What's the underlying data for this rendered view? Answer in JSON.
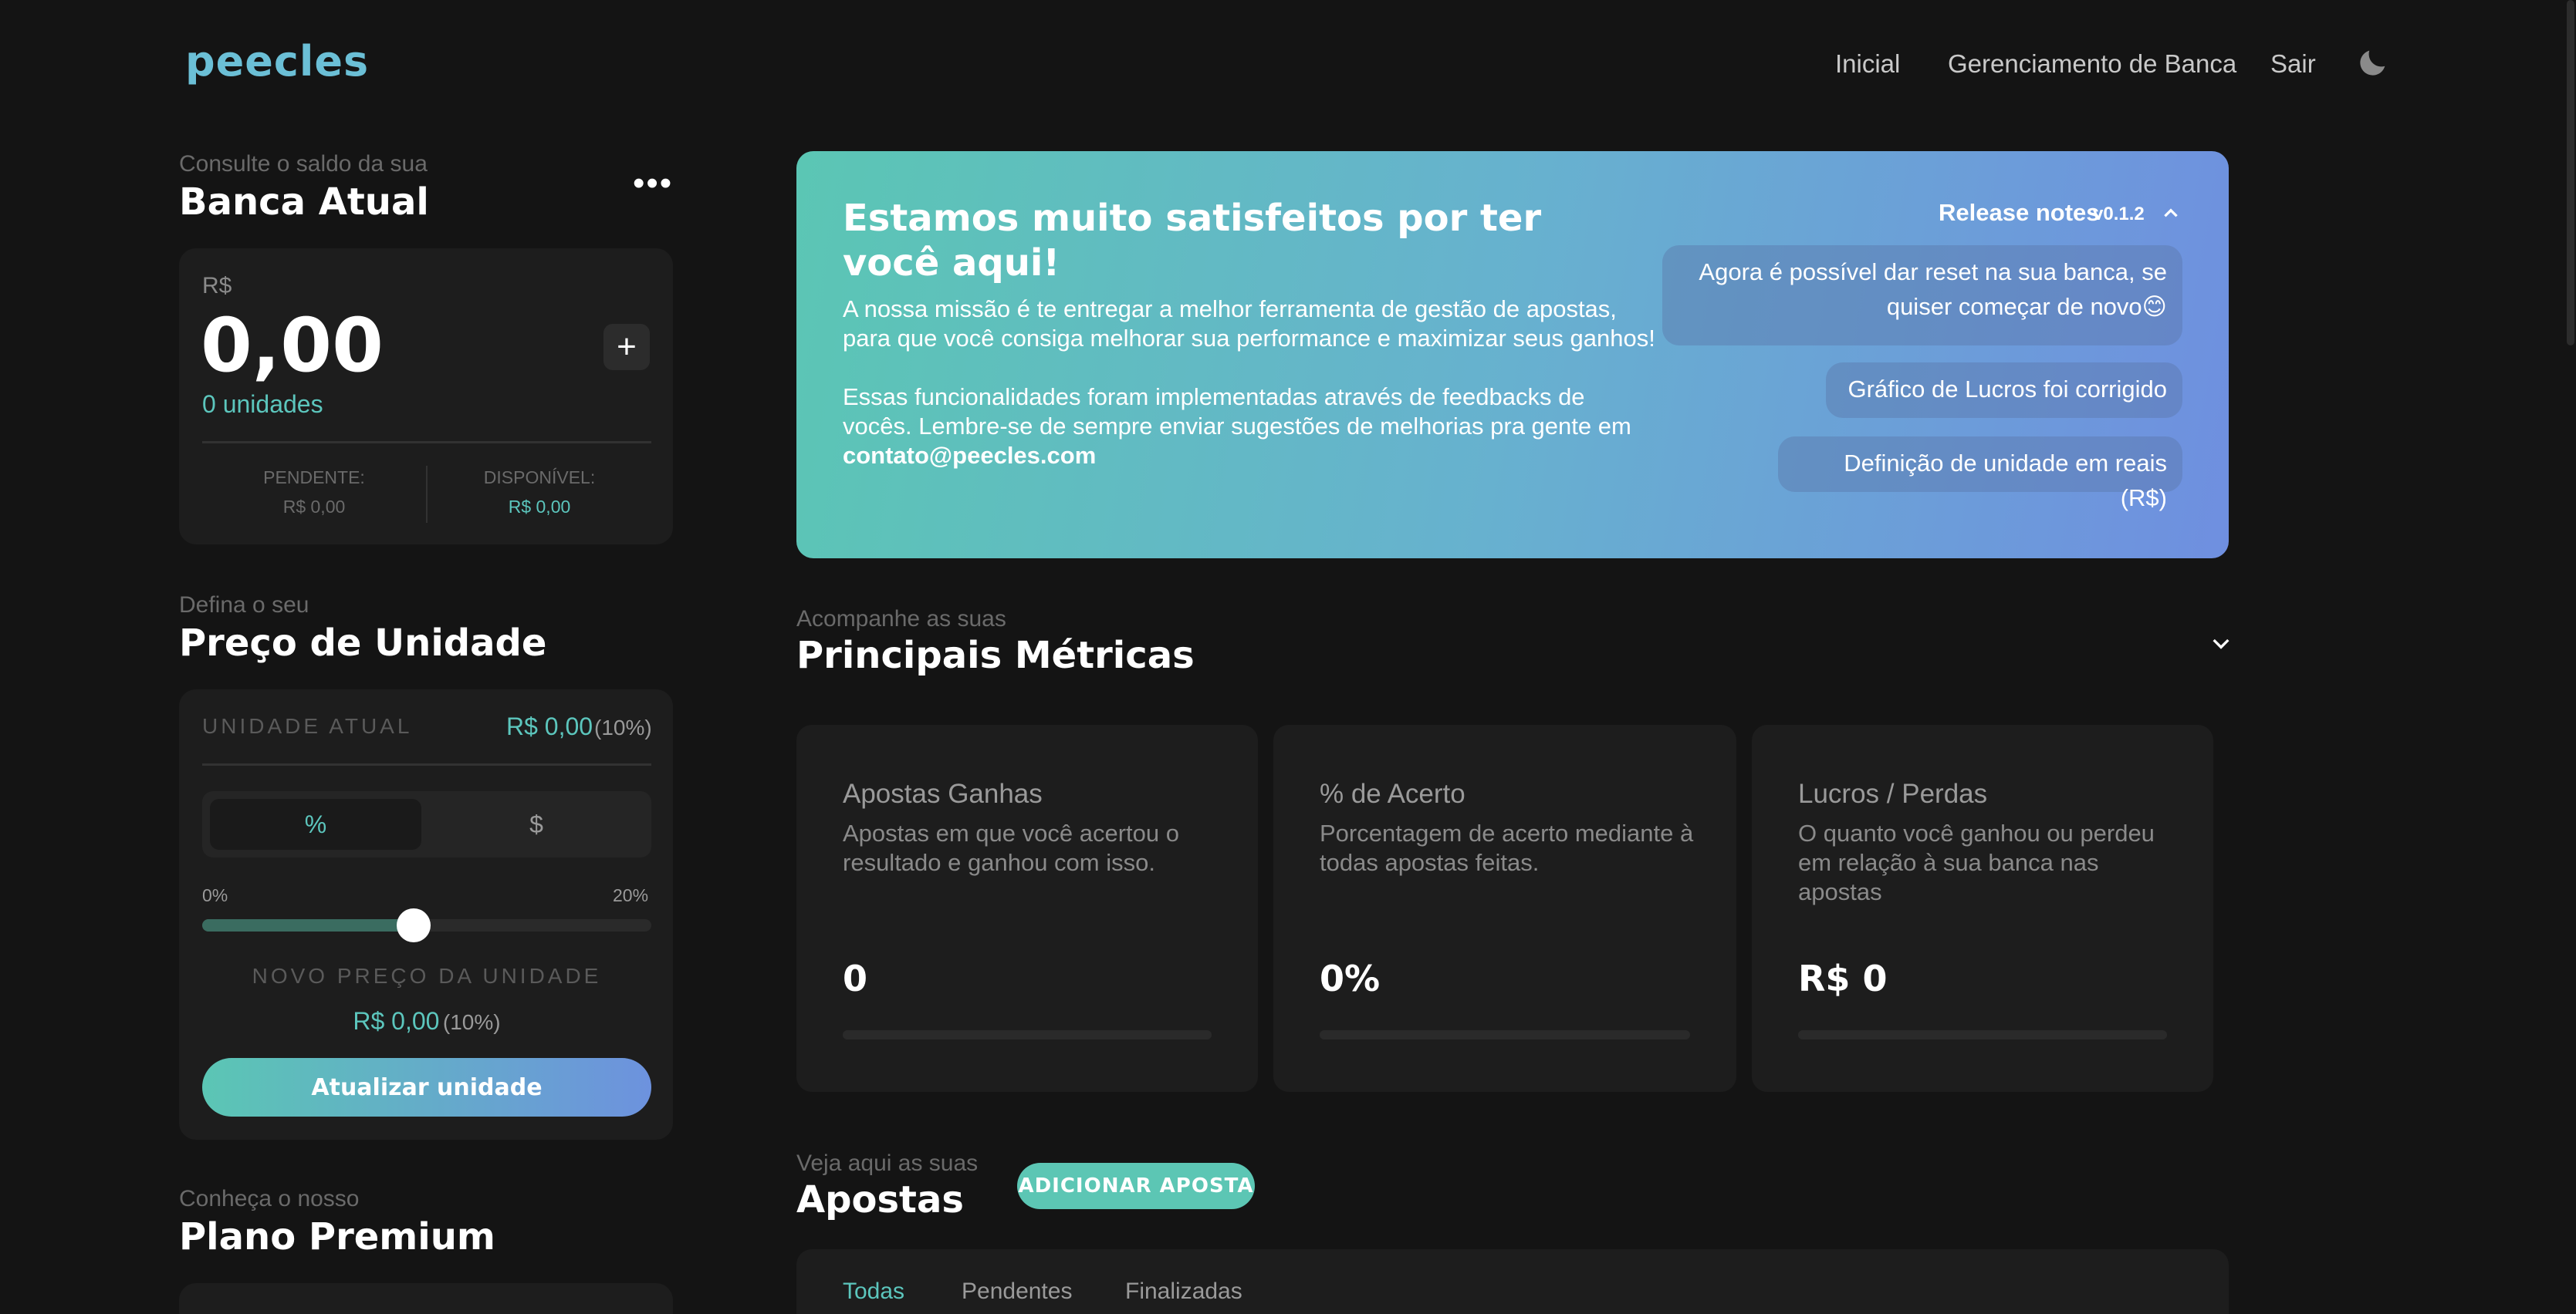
{
  "header": {
    "logo": "peecles",
    "nav": [
      "Inicial",
      "Gerenciamento de Banca",
      "Sair"
    ],
    "theme_icon": "moon-icon"
  },
  "bank": {
    "eyebrow": "Consulte o saldo da sua",
    "title": "Banca Atual",
    "menu": "•••",
    "currency": "R$",
    "amount": "0,00",
    "units": "0 unidades",
    "add": "+",
    "pending_label": "PENDENTE:",
    "pending_value": "R$ 0,00",
    "available_label": "DISPONÍVEL:",
    "available_value": "R$ 0,00"
  },
  "unit": {
    "eyebrow": "Defina o seu",
    "title": "Preço de Unidade",
    "current_label": "UNIDADE ATUAL",
    "current_value": "R$ 0,00",
    "current_pct": "(10%)",
    "mode_percent": "%",
    "mode_currency": "$",
    "slider_min": "0%",
    "slider_max": "20%",
    "slider_value": 0.47,
    "new_label": "NOVO PREÇO DA UNIDADE",
    "new_value": "R$ 0,00",
    "new_pct": "(10%)",
    "update_button": "Atualizar unidade"
  },
  "premium": {
    "eyebrow": "Conheça o nosso",
    "title": "Plano Premium"
  },
  "hero": {
    "title": "Estamos muito satisfeitos por ter você aqui!",
    "text1": "A nossa missão é te entregar a melhor ferramenta de gestão de apostas, para que você consiga melhorar sua performance e maximizar seus ganhos!",
    "text2": "Essas funcionalidades foram implementadas através de feedbacks de vocês. Lembre-se de sempre enviar sugestões de melhorias pra gente em",
    "email": "contato@peecles.com",
    "release_label": "Release notes",
    "release_version": "v0.1.2",
    "notes": [
      "Agora é possível dar reset na sua banca, se quiser começar de novo😊",
      "Gráfico de Lucros foi corrigido",
      "Definição de unidade em reais (R$)"
    ]
  },
  "metrics": {
    "eyebrow": "Acompanhe as suas",
    "title": "Principais Métricas",
    "cards": [
      {
        "title": "Apostas Ganhas",
        "desc": "Apostas em que você acertou o resultado e ganhou com isso.",
        "value": "0"
      },
      {
        "title": "% de Acerto",
        "desc": "Porcentagem de acerto mediante à todas apostas feitas.",
        "value": "0%"
      },
      {
        "title": "Lucros / Perdas",
        "desc": "O quanto você ganhou ou perdeu em relação à sua banca nas apostas",
        "value": "R$ 0"
      }
    ]
  },
  "bets": {
    "eyebrow": "Veja aqui as suas",
    "title": "Apostas",
    "add_button": "ADICIONAR APOSTA",
    "tabs": [
      "Todas",
      "Pendentes",
      "Finalizadas"
    ]
  },
  "colors": {
    "accent": "#5cc6bd",
    "gradient_start": "#5bc6b4",
    "gradient_end": "#6f8fe0"
  }
}
